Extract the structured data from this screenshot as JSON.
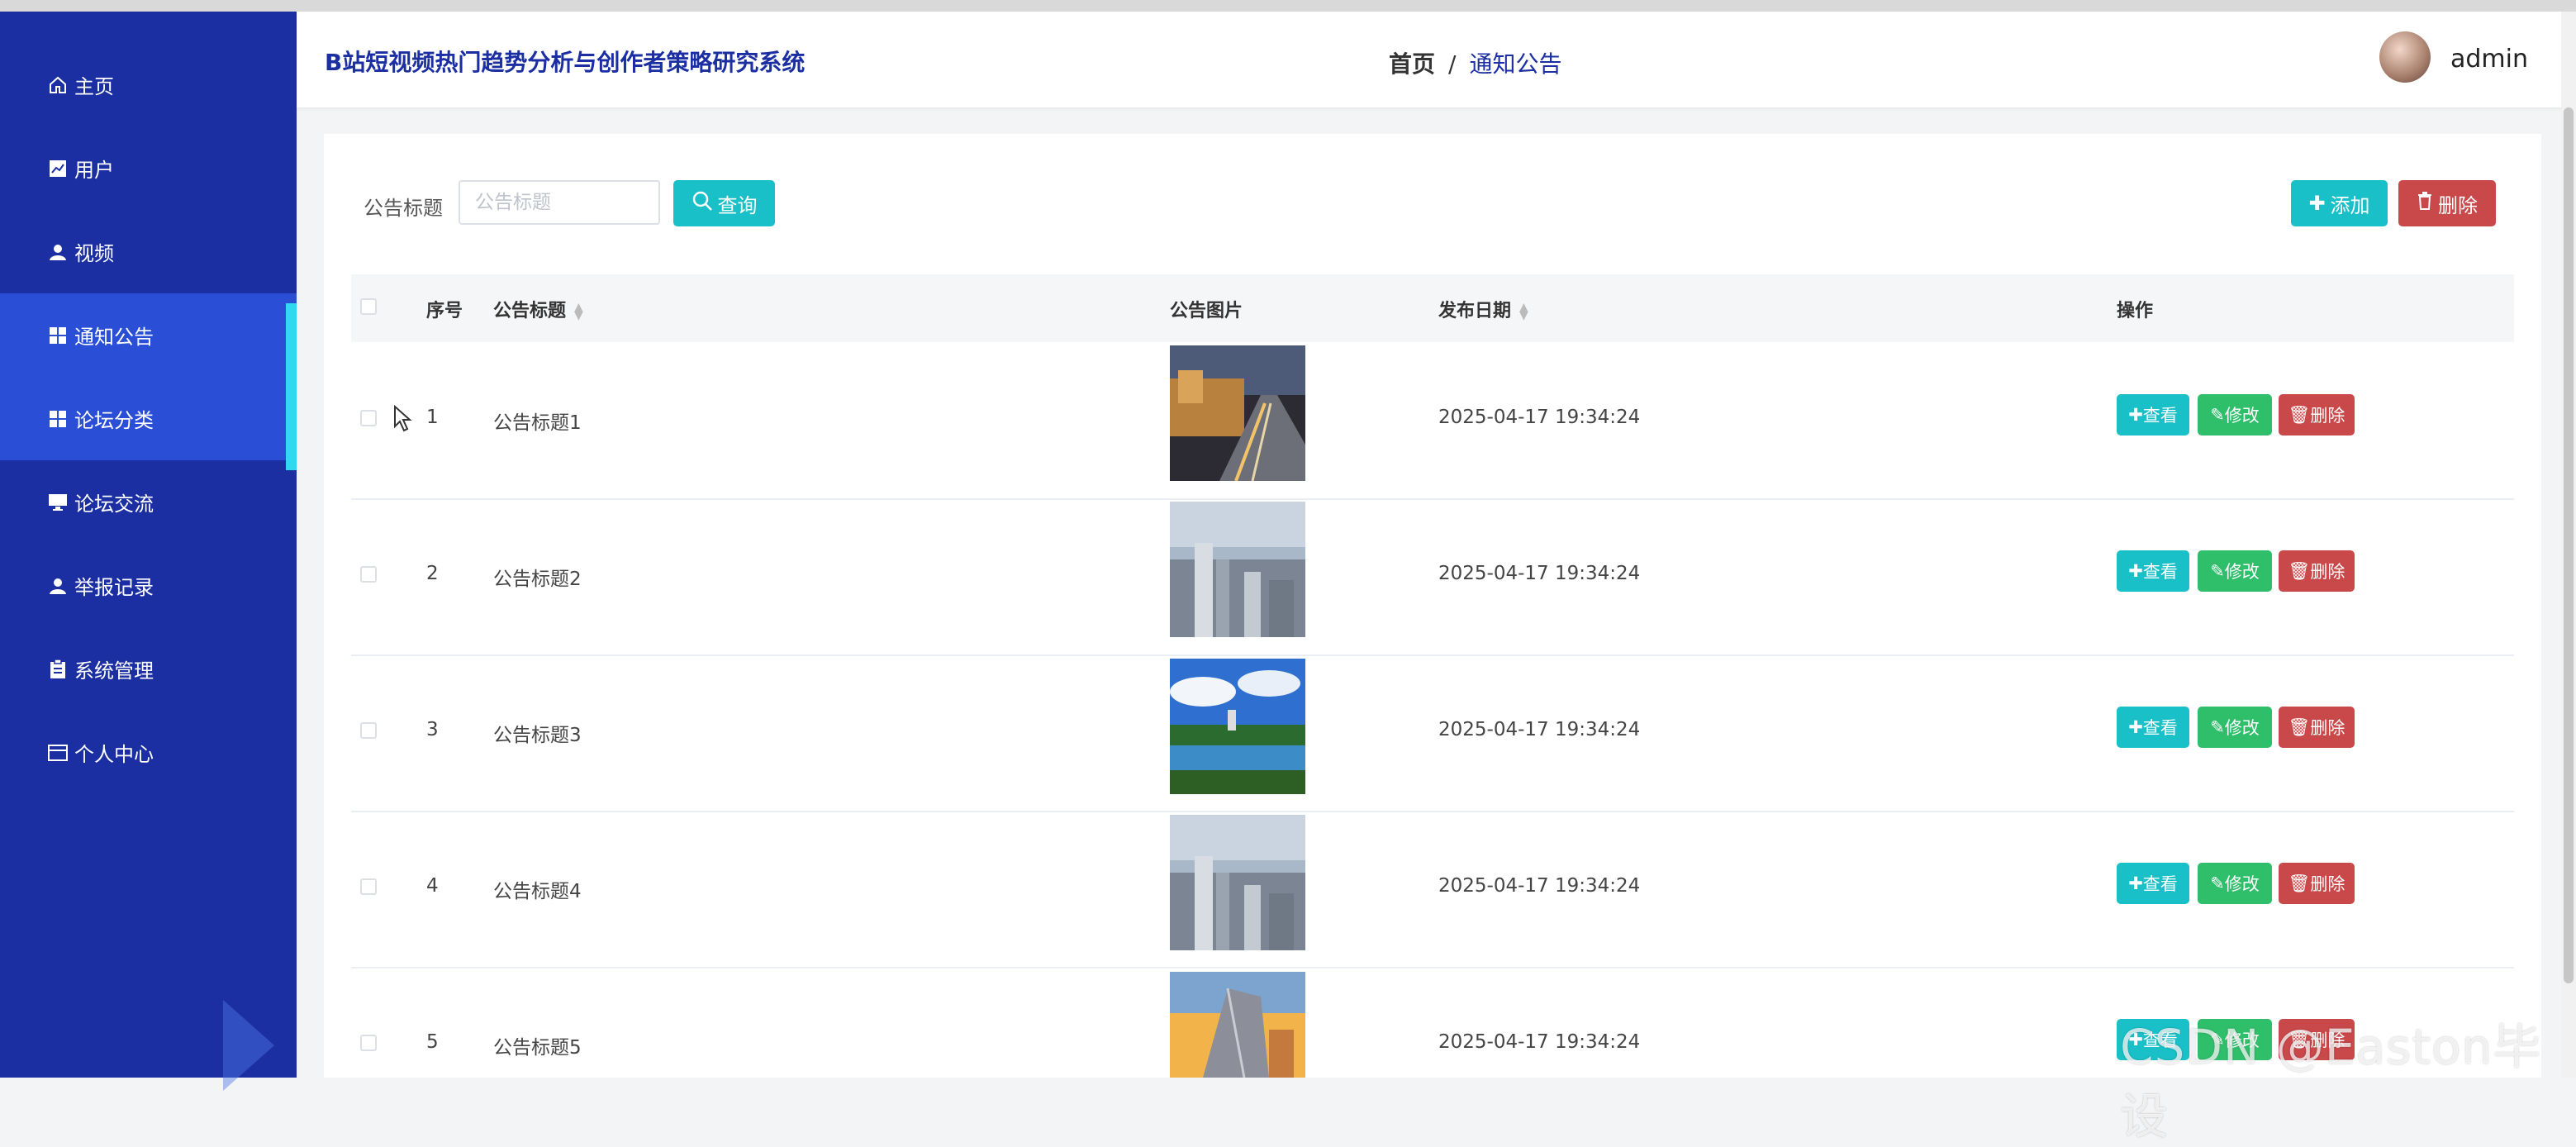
{
  "app": {
    "system_title": "B站短视频热门趋势分析与创作者策略研究系统",
    "username": "admin"
  },
  "breadcrumb": {
    "home": "首页",
    "separator": "/",
    "current": "通知公告"
  },
  "sidebar": {
    "items": [
      {
        "label": "主页",
        "icon": "home-icon"
      },
      {
        "label": "用户",
        "icon": "chart-icon"
      },
      {
        "label": "视频",
        "icon": "user-icon"
      },
      {
        "label": "通知公告",
        "icon": "grid-icon",
        "active": true
      },
      {
        "label": "论坛分类",
        "icon": "grid-icon",
        "active": true
      },
      {
        "label": "论坛交流",
        "icon": "monitor-icon"
      },
      {
        "label": "举报记录",
        "icon": "user-icon"
      },
      {
        "label": "系统管理",
        "icon": "clipboard-icon"
      },
      {
        "label": "个人中心",
        "icon": "card-icon"
      }
    ]
  },
  "search": {
    "label": "公告标题",
    "placeholder": "公告标题",
    "value": "",
    "query_label": "查询"
  },
  "toolbar": {
    "add_label": "添加",
    "delete_label": "删除"
  },
  "table": {
    "columns": {
      "index": "序号",
      "title": "公告标题",
      "image": "公告图片",
      "date": "发布日期",
      "actions": "操作"
    },
    "action_labels": {
      "view": "查看",
      "edit": "修改",
      "delete": "删除"
    },
    "rows": [
      {
        "index": "1",
        "title": "公告标题1",
        "date": "2025-04-17 19:34:24",
        "image": "city-night-street"
      },
      {
        "index": "2",
        "title": "公告标题2",
        "date": "2025-04-17 19:34:24",
        "image": "city-skyline"
      },
      {
        "index": "3",
        "title": "公告标题3",
        "date": "2025-04-17 19:34:24",
        "image": "lake-park"
      },
      {
        "index": "4",
        "title": "公告标题4",
        "date": "2025-04-17 19:34:24",
        "image": "city-skyline"
      },
      {
        "index": "5",
        "title": "公告标题5",
        "date": "2025-04-17 19:34:24",
        "image": "skyscraper-sunset"
      }
    ]
  },
  "watermark": "CSDN @Easton毕设",
  "colors": {
    "sidebar": "#1b2fa3",
    "accent": "#19c0c7",
    "success": "#2fbf6b",
    "danger": "#c9484a",
    "active_bar": "#33d8f0"
  }
}
